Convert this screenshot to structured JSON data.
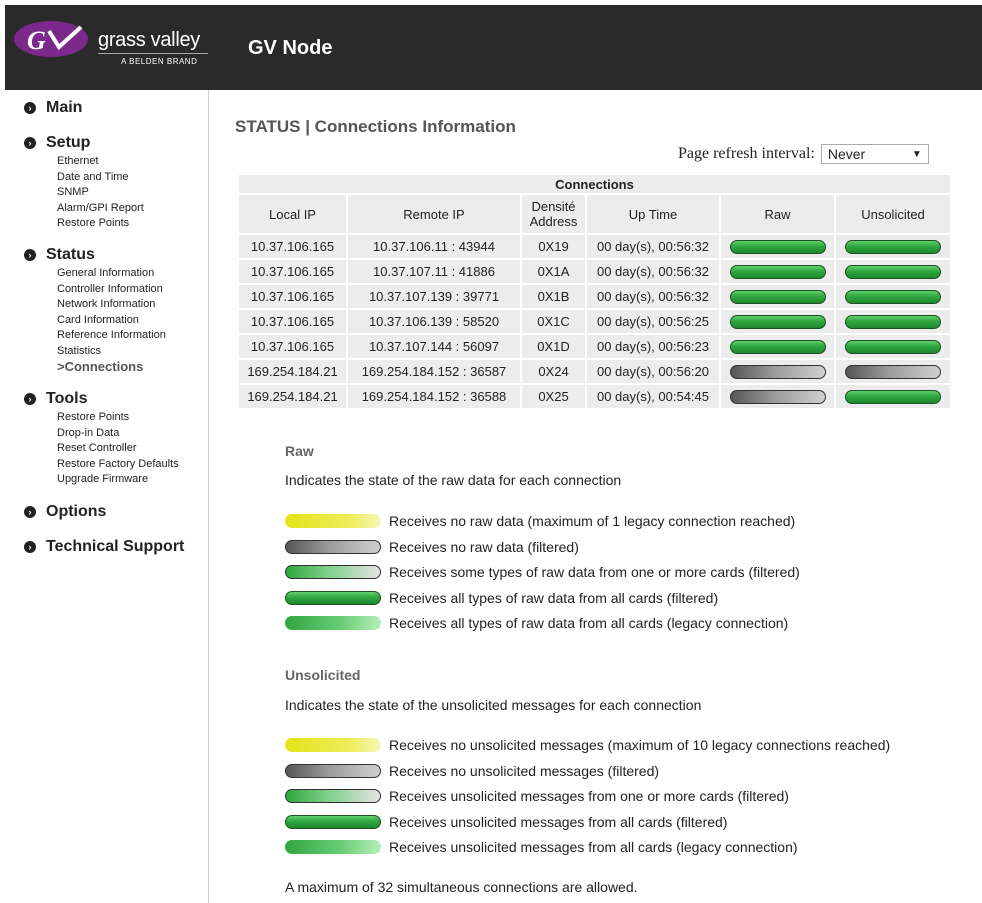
{
  "brand": {
    "logo_name": "grass valley",
    "logo_sub": "A BELDEN BRAND",
    "app_title": "GV Node"
  },
  "sidebar": {
    "sections": [
      {
        "label": "Main",
        "items": []
      },
      {
        "label": "Setup",
        "items": [
          "Ethernet",
          "Date and Time",
          "SNMP",
          "Alarm/GPI Report",
          "Restore Points"
        ]
      },
      {
        "label": "Status",
        "items": [
          "General Information",
          "Controller Information",
          "Network Information",
          "Card Information",
          "Reference Information",
          "Statistics",
          ">Connections"
        ]
      },
      {
        "label": "Tools",
        "items": [
          "Restore Points",
          "Drop-in Data",
          "Reset Controller",
          "Restore Factory Defaults",
          "Upgrade Firmware"
        ]
      },
      {
        "label": "Options",
        "items": []
      },
      {
        "label": "Technical Support",
        "items": []
      }
    ]
  },
  "page": {
    "title": "STATUS | Connections Information",
    "refresh_label": "Page refresh interval:",
    "refresh_value": "Never"
  },
  "table": {
    "caption": "Connections",
    "columns": [
      "Local IP",
      "Remote IP",
      "Densité Address",
      "Up Time",
      "Raw",
      "Unsolicited"
    ],
    "rows": [
      {
        "local": "10.37.106.165",
        "remote": "10.37.106.11 : 43944",
        "addr": "0X19",
        "uptime": "00 day(s), 00:56:32",
        "raw": "green",
        "unsol": "green"
      },
      {
        "local": "10.37.106.165",
        "remote": "10.37.107.11 : 41886",
        "addr": "0X1A",
        "uptime": "00 day(s), 00:56:32",
        "raw": "green",
        "unsol": "green"
      },
      {
        "local": "10.37.106.165",
        "remote": "10.37.107.139 : 39771",
        "addr": "0X1B",
        "uptime": "00 day(s), 00:56:32",
        "raw": "green",
        "unsol": "green"
      },
      {
        "local": "10.37.106.165",
        "remote": "10.37.106.139 : 58520",
        "addr": "0X1C",
        "uptime": "00 day(s), 00:56:25",
        "raw": "green",
        "unsol": "green"
      },
      {
        "local": "10.37.106.165",
        "remote": "10.37.107.144 : 56097",
        "addr": "0X1D",
        "uptime": "00 day(s), 00:56:23",
        "raw": "green",
        "unsol": "green"
      },
      {
        "local": "169.254.184.21",
        "remote": "169.254.184.152 : 36587",
        "addr": "0X24",
        "uptime": "00 day(s), 00:56:20",
        "raw": "gray",
        "unsol": "gray"
      },
      {
        "local": "169.254.184.21",
        "remote": "169.254.184.152 : 36588",
        "addr": "0X25",
        "uptime": "00 day(s), 00:54:45",
        "raw": "gray",
        "unsol": "green"
      }
    ]
  },
  "legend_raw": {
    "title": "Raw",
    "description": "Indicates the state of the raw data for each connection",
    "items": [
      {
        "style": "yellow",
        "text": "Receives no raw data (maximum of 1 legacy connection reached)"
      },
      {
        "style": "gray",
        "text": "Receives no raw data (filtered)"
      },
      {
        "style": "partial",
        "text": "Receives some types of raw data from one or more cards (filtered)"
      },
      {
        "style": "green",
        "text": "Receives all types of raw data from all cards (filtered)"
      },
      {
        "style": "legacy",
        "text": "Receives all types of raw data from all cards (legacy connection)"
      }
    ]
  },
  "legend_unsol": {
    "title": "Unsolicited",
    "description": "Indicates the state of the unsolicited messages for each connection",
    "items": [
      {
        "style": "yellow",
        "text": "Receives no unsolicited messages (maximum of 10 legacy connections reached)"
      },
      {
        "style": "gray",
        "text": "Receives no unsolicited messages (filtered)"
      },
      {
        "style": "partial",
        "text": "Receives unsolicited messages from one or more cards (filtered)"
      },
      {
        "style": "green",
        "text": "Receives unsolicited messages from all cards (filtered)"
      },
      {
        "style": "legacy",
        "text": "Receives unsolicited messages from all cards (legacy connection)"
      }
    ]
  },
  "footer_note": "A maximum of 32 simultaneous connections are allowed.",
  "colors": {
    "header_bg": "#2a2a2a",
    "logo_purple": "#7b2a8c",
    "status_green": "#2fa640",
    "status_gray": "#8a8a8a",
    "status_yellow": "#dede20"
  }
}
